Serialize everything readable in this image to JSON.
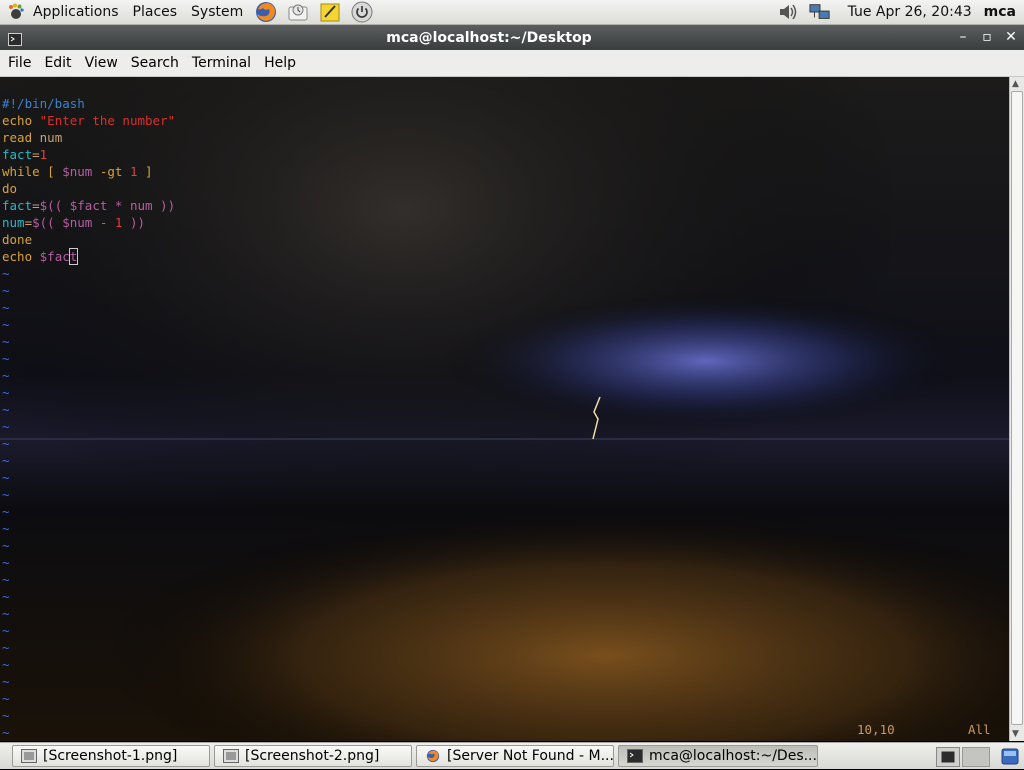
{
  "top_panel": {
    "menus": [
      "Applications",
      "Places",
      "System"
    ],
    "clock": "Tue Apr 26, 20:43",
    "username": "mca"
  },
  "window": {
    "title": "mca@localhost:~/Desktop"
  },
  "menubar": [
    "File",
    "Edit",
    "View",
    "Search",
    "Terminal",
    "Help"
  ],
  "editor": {
    "lines": [
      "#!/bin/bash",
      "echo \"Enter the number\"",
      "read num",
      "fact=1",
      "while [ $num -gt 1 ]",
      "do",
      "fact=$(( $fact * num ))",
      "num=$(( $num - 1 ))",
      "done",
      "echo $fact"
    ],
    "tilde": "~",
    "position": "10,10",
    "scroll": "All"
  },
  "taskbar": [
    {
      "label": "[Screenshot-1.png]",
      "icon": "image-viewer-icon"
    },
    {
      "label": "[Screenshot-2.png]",
      "icon": "image-viewer-icon"
    },
    {
      "label": "[Server Not Found - M...",
      "icon": "firefox-icon"
    },
    {
      "label": "mca@localhost:~/Des...",
      "icon": "terminal-icon"
    }
  ]
}
